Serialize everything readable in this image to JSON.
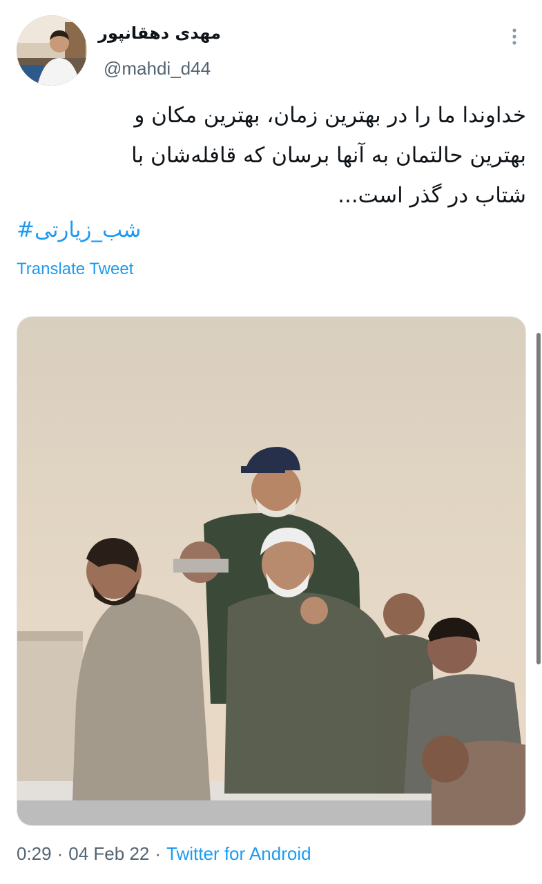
{
  "author": {
    "display_name": "مهدی دهقانپور",
    "handle": "@mahdi_d44"
  },
  "tweet": {
    "text_lines": [
      "خداوندا ما را در بهترین زمان، بهترین مکان و",
      "بهترین حالتمان به آنها برسان که قافله‌شان با",
      "شتاب در گذر است..."
    ],
    "hashtag": "شب_زیارتی#",
    "translate_label": "Translate Tweet",
    "media_description_icon": "photo"
  },
  "meta": {
    "time": "0:29",
    "separator": "·",
    "date": "04 Feb 22",
    "source": "Twitter for Android"
  },
  "colors": {
    "link": "#1d9bf0",
    "secondary_text": "#536471",
    "primary_text": "#0f1419"
  },
  "icons": {
    "more": "more-vertical-icon"
  }
}
